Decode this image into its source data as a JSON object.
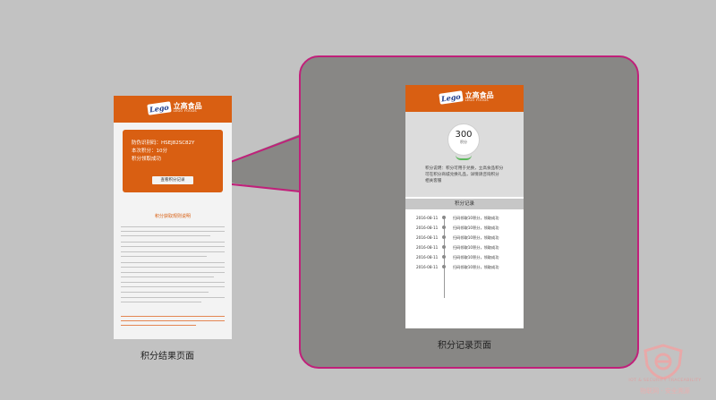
{
  "brand": {
    "logo_mark": "Lego",
    "name_cn": "立高食品",
    "name_en": "LEGO FOODS"
  },
  "left_screen": {
    "card_lines": [
      "防伪识别码：HSEJ82SC82Y",
      "本次积分：10分",
      "积分领取成功"
    ],
    "button_label": "查看积分记录",
    "rules_title": "积分获取规则说明",
    "caption": "积分结果页面"
  },
  "right_screen": {
    "score_value": "300",
    "score_unit": "积分",
    "info_lines": [
      "积分说明：积分可用于兑换，立高食品积分",
      "可在积分商城兑换礼品，详情请咨询积分",
      "相关客服"
    ],
    "records_title": "积分记录",
    "records": [
      {
        "date": "2016-08-11",
        "text": "扫码领取10积分，领取成功"
      },
      {
        "date": "2016-08-11",
        "text": "扫码领取10积分，领取成功"
      },
      {
        "date": "2016-08-11",
        "text": "扫码领取10积分，领取成功"
      },
      {
        "date": "2016-08-11",
        "text": "扫码领取10积分，领取成功"
      },
      {
        "date": "2016-08-11",
        "text": "扫码领取10积分，领取成功"
      },
      {
        "date": "2016-08-11",
        "text": "扫码领取10积分，领取成功"
      }
    ],
    "caption": "积分记录页面"
  },
  "watermark": {
    "en": "IOT & SECURITY TRACEABILITY",
    "cn": "物联网 · 安全溯源"
  },
  "colors": {
    "background": "#c2c2c2",
    "accent_orange": "#d95f12",
    "callout_border": "#c0207a",
    "callout_fill": "#888785"
  }
}
